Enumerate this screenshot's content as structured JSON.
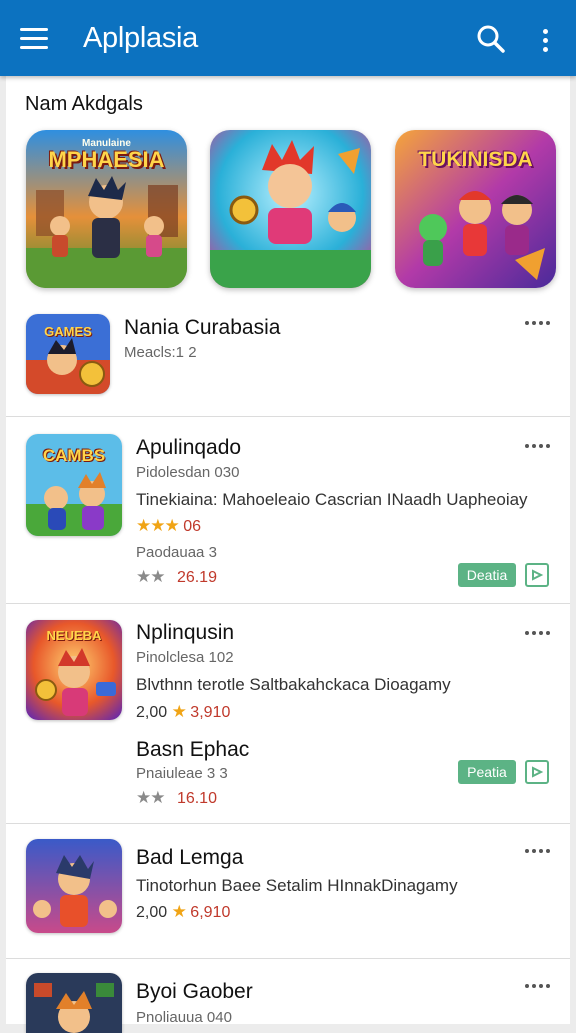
{
  "appbar": {
    "title": "Aplplasia",
    "menu_icon": "hamburger-menu-icon",
    "search_icon": "search-icon",
    "more_icon": "more-vert-icon",
    "color": "#0c72c0"
  },
  "featured": {
    "title": "Nam Akdgals",
    "items": [
      {
        "art_text": "MPHAESIA",
        "art_top": "Manulaine"
      },
      {
        "art_text": "",
        "art_top": ""
      },
      {
        "art_text": "TUKINISDA",
        "art_top": ""
      }
    ]
  },
  "list": [
    {
      "title": "Nania Curabasia",
      "subtitle": "Meacls:1 2",
      "icon_text": "GAMES"
    },
    {
      "title": "Apulinqado",
      "subtitle": "Pidolesdan 030",
      "description": "Tinekiaina: Mahoeleaio Cascrian INaadh Uapheoiay",
      "stars": "★★★",
      "rating": "06",
      "sub2": "Paodauaa 3",
      "stars2": "★★",
      "price": "26.19",
      "badge": "Deatia",
      "icon_text": "CAMBS"
    },
    {
      "title": "Nplinqusin",
      "subtitle": "Pinolclesa 102",
      "description": "Blvthnn terotle Saltbakahckaca Dioagamy",
      "rating_prefix": "2,00",
      "stars": "★",
      "rating": "3,910",
      "sub_title": "Basn Ephac",
      "sub2": "Pnaiuleae 3 3",
      "stars2": "★★",
      "price": "16.10",
      "badge": "Peatia",
      "icon_text": "NEUEBA"
    },
    {
      "title": "Bad Lemga",
      "description": "Tinotorhun Baee Setalim HInnakDinagamy",
      "rating_prefix": "2,00",
      "stars": "★",
      "rating": "6,910",
      "icon_text": ""
    },
    {
      "title": "Byoi Gaober",
      "subtitle": "Pnoliauua 040",
      "icon_text": ""
    }
  ]
}
